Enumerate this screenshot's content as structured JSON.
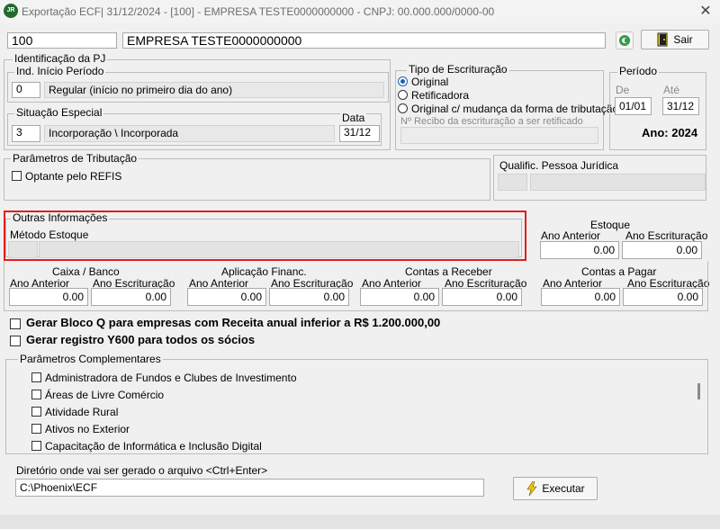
{
  "window": {
    "title": "Exportação ECF| 31/12/2024 - [100] - EMPRESA TESTE0000000000 - CNPJ: 00.000.000/0000-00",
    "icon_text": "JR"
  },
  "header": {
    "company_code": "100",
    "company_name": "EMPRESA TESTE0000000000",
    "exit_label": "Sair"
  },
  "identification": {
    "legend": "Identificação da PJ",
    "inicio": {
      "legend": "Ind. Início Período",
      "code": "0",
      "description": "Regular (início no primeiro dia do ano)"
    },
    "situacao": {
      "legend": "Situação Especial",
      "code": "3",
      "description": "Incorporação \\ Incorporada",
      "date_label": "Data",
      "date": "31/12"
    }
  },
  "escrituracao": {
    "legend": "Tipo de Escrituração",
    "options": [
      "Original",
      "Retificadora",
      "Original c/ mudança da forma de tributação"
    ],
    "selected": 0,
    "recibo_placeholder": "Nº Recibo da escrituração a ser retificado"
  },
  "periodo": {
    "legend": "Período",
    "de_label": "De",
    "ate_label": "Até",
    "de": "01/01",
    "ate": "31/12",
    "ano_label": "Ano: 2024"
  },
  "tributacao": {
    "legend": "Parâmetros de Tributação",
    "refis_label": "Optante pelo REFIS",
    "qualific_label": "Qualific. Pessoa Jurídica"
  },
  "outras": {
    "legend": "Outras Informações",
    "metodo_label": "Método Estoque"
  },
  "estoque": {
    "title": "Estoque",
    "ano_anterior_label": "Ano Anterior",
    "ano_escrit_label": "Ano Escrituração",
    "ano_anterior": "0.00",
    "ano_escrit": "0.00"
  },
  "balances": [
    {
      "title": "Caixa / Banco",
      "left_label": "Ano  Anterior",
      "right_label": "Ano Escrituração",
      "left": "0.00",
      "right": "0.00"
    },
    {
      "title": "Aplicação Financ.",
      "left_label": "Ano  Anterior",
      "right_label": "Ano Escrituração",
      "left": "0.00",
      "right": "0.00"
    },
    {
      "title": "Contas a Receber",
      "left_label": "Ano Anterior",
      "right_label": "Ano Escrituração",
      "left": "0.00",
      "right": "0.00"
    },
    {
      "title": "Contas a Pagar",
      "left_label": "Ano Anterior",
      "right_label": "Ano Escrituração",
      "left": "0.00",
      "right": "0.00"
    }
  ],
  "options": {
    "bloco_q": "Gerar Bloco Q para empresas com Receita anual inferior a R$ 1.200.000,00",
    "y600": "Gerar registro Y600 para todos os sócios"
  },
  "complementares": {
    "legend": "Parâmetros Complementares",
    "items": [
      "Administradora de Fundos e Clubes de Investimento",
      "Áreas de Livre Comércio",
      "Atividade Rural",
      "Ativos no Exterior",
      "Capacitação de Informática e Inclusão Digital"
    ]
  },
  "output": {
    "label": "Diretório onde vai ser gerado o arquivo <Ctrl+Enter>",
    "path": "C:\\Phoenix\\ECF",
    "execute_label": "Executar"
  },
  "colors": {
    "highlight": "#e01e1e",
    "radio_accent": "#1a5fb4"
  }
}
